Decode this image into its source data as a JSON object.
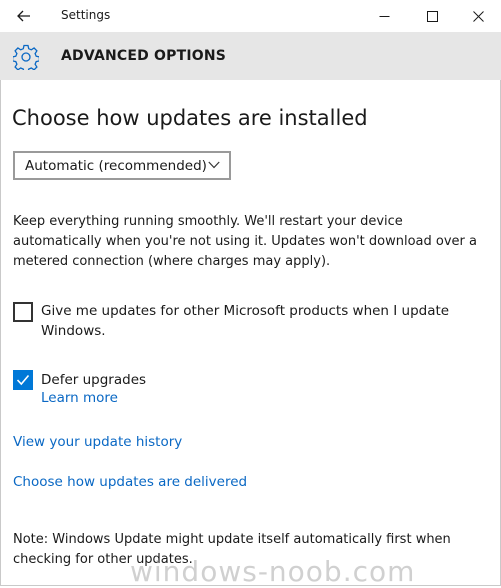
{
  "window": {
    "title": "Settings",
    "back_icon": "back-arrow-icon",
    "controls": [
      "minimize-icon",
      "maximize-icon",
      "close-icon"
    ]
  },
  "header": {
    "icon": "gear-icon",
    "title": "ADVANCED OPTIONS"
  },
  "main": {
    "heading": "Choose how updates are installed",
    "install_mode": {
      "selected": "Automatic (recommended)",
      "icon": "chevron-down-icon"
    },
    "description": "Keep everything running smoothly. We'll restart your device automatically when you're not using it. Updates won't download over a metered connection (where charges may apply).",
    "options": [
      {
        "label": "Give me updates for other Microsoft products when I update Windows.",
        "checked": false
      },
      {
        "label": "Defer upgrades",
        "checked": true
      }
    ],
    "learn_more": "Learn more",
    "links": {
      "history": "View your update history",
      "delivery": "Choose how updates are delivered"
    },
    "note": "Note: Windows Update might update itself automatically first when checking for other updates."
  },
  "watermark": "windows-noob.com",
  "colors": {
    "accent": "#0078d7",
    "link": "#0a68c4",
    "header_band": "#e6e6e6"
  }
}
